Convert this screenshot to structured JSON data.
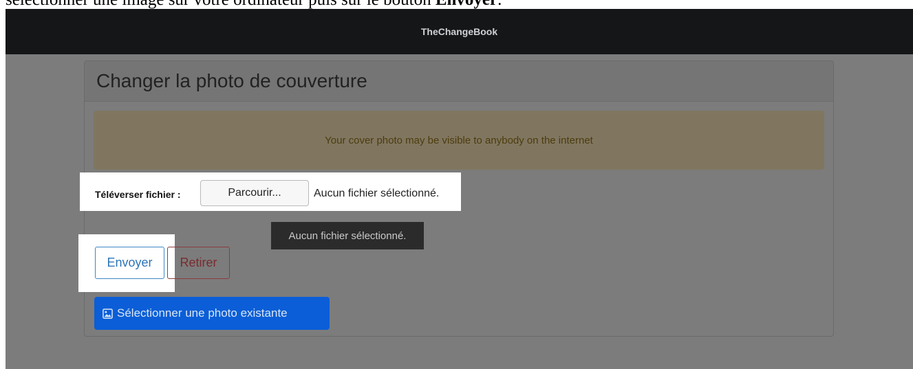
{
  "caption": {
    "text": "sélectionner une image sur votre ordinateur puis sur le bouton ",
    "bold": "Envoyer",
    "end": "."
  },
  "navbar": {
    "brand": "TheChangeBook"
  },
  "card": {
    "title": "Changer la photo de couverture",
    "alert": "Your cover photo may be visible to anybody on the internet"
  },
  "upload": {
    "label": "Téléverser fichier :",
    "browse_label": "Parcourir...",
    "status": "Aucun fichier sélectionné.",
    "tooltip": "Aucun fichier sélectionné."
  },
  "actions": {
    "send_label": "Envoyer",
    "remove_label": "Retirer",
    "existing_label": "Sélectionner une photo existante",
    "existing_icon": "image-icon"
  },
  "colors": {
    "navbar": "#141618",
    "primary": "#0b5ed7",
    "danger": "#8c3b3f",
    "alert_bg": "#807660"
  }
}
